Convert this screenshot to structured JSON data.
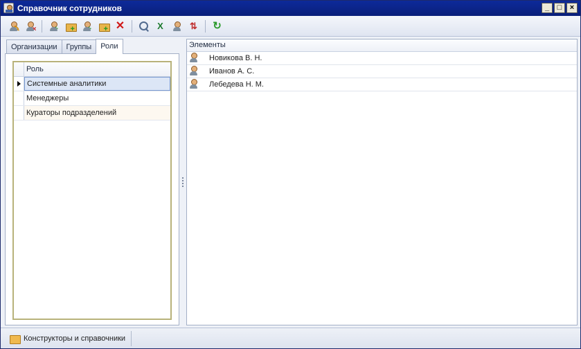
{
  "window": {
    "title": "Справочник сотрудников",
    "controls": {
      "minimize": "_",
      "maximize": "□",
      "close": "×"
    }
  },
  "toolbar": {
    "icons": [
      "edit-icon",
      "delete-user-icon",
      "add-user-icon",
      "add-folder-icon",
      "add-item-icon",
      "add-subitem-icon",
      "delete-icon",
      "search-icon",
      "excel-icon",
      "user-icon",
      "transfer-icon",
      "refresh-icon"
    ]
  },
  "left_panel": {
    "tabs": [
      {
        "label": "Организации",
        "active": false
      },
      {
        "label": "Группы",
        "active": false
      },
      {
        "label": "Роли",
        "active": true
      }
    ],
    "grid": {
      "column": "Роль",
      "rows": [
        "Системные аналитики",
        "Менеджеры",
        "Кураторы подразделений"
      ],
      "selected_index": 0
    }
  },
  "right_panel": {
    "column": "Элементы",
    "rows": [
      "Новикова В. Н.",
      "Иванов А. С.",
      "Лебедева Н. М."
    ]
  },
  "bottom_bar": {
    "item": "Конструкторы и справочники"
  },
  "colors": {
    "title_bar": "#0d2a9a",
    "selection": "#dce6f6",
    "grid_border": "#b8b27a"
  }
}
